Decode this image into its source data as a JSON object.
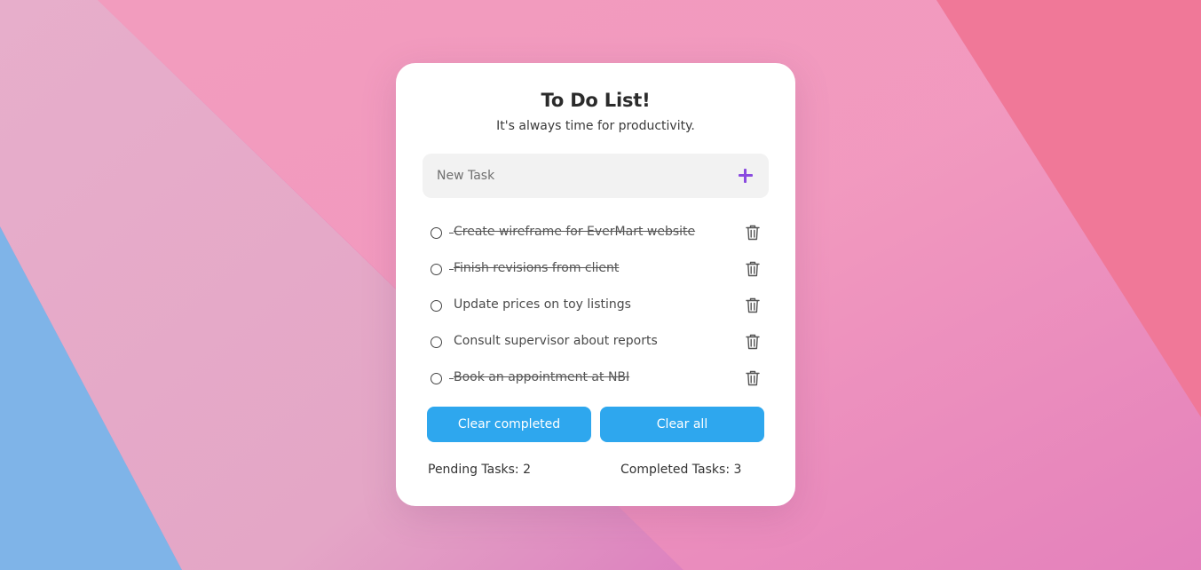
{
  "app": {
    "title": "To Do List!",
    "subtitle": "It's always time for productivity."
  },
  "new_task": {
    "placeholder": "New Task",
    "value": "",
    "add_icon": "plus-icon",
    "add_icon_color": "#8a4bdf"
  },
  "tasks": [
    {
      "label": "Create wireframe for EverMart website",
      "completed": true
    },
    {
      "label": "Finish revisions from client",
      "completed": true
    },
    {
      "label": "Update prices on toy listings",
      "completed": false
    },
    {
      "label": "Consult supervisor about reports",
      "completed": false
    },
    {
      "label": "Book an appointment at NBI",
      "completed": true
    }
  ],
  "task_delete_icon": "trash-icon",
  "actions": {
    "clear_completed_label": "Clear completed",
    "clear_all_label": "Clear all"
  },
  "stats": {
    "pending_text": "Pending Tasks: 2",
    "completed_text": "Completed Tasks: 3"
  },
  "colors": {
    "button": "#2ea7ee",
    "accent": "#8a4bdf",
    "card": "#ffffff",
    "input_bg": "#f2f2f2"
  }
}
